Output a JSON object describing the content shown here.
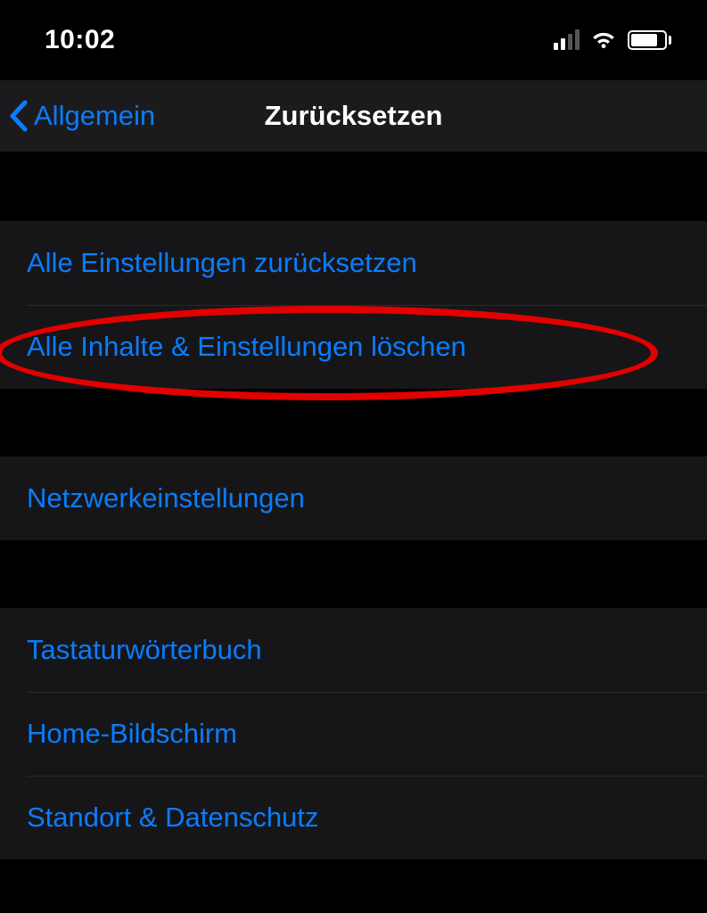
{
  "status": {
    "time": "10:02"
  },
  "nav": {
    "back_label": "Allgemein",
    "title": "Zurücksetzen"
  },
  "groups": {
    "group1": {
      "item0": "Alle Einstellungen zurücksetzen",
      "item1": "Alle Inhalte & Einstellungen löschen"
    },
    "group2": {
      "item0": "Netzwerkeinstellungen"
    },
    "group3": {
      "item0": "Tastaturwörterbuch",
      "item1": "Home-Bildschirm",
      "item2": "Standort & Datenschutz"
    }
  }
}
